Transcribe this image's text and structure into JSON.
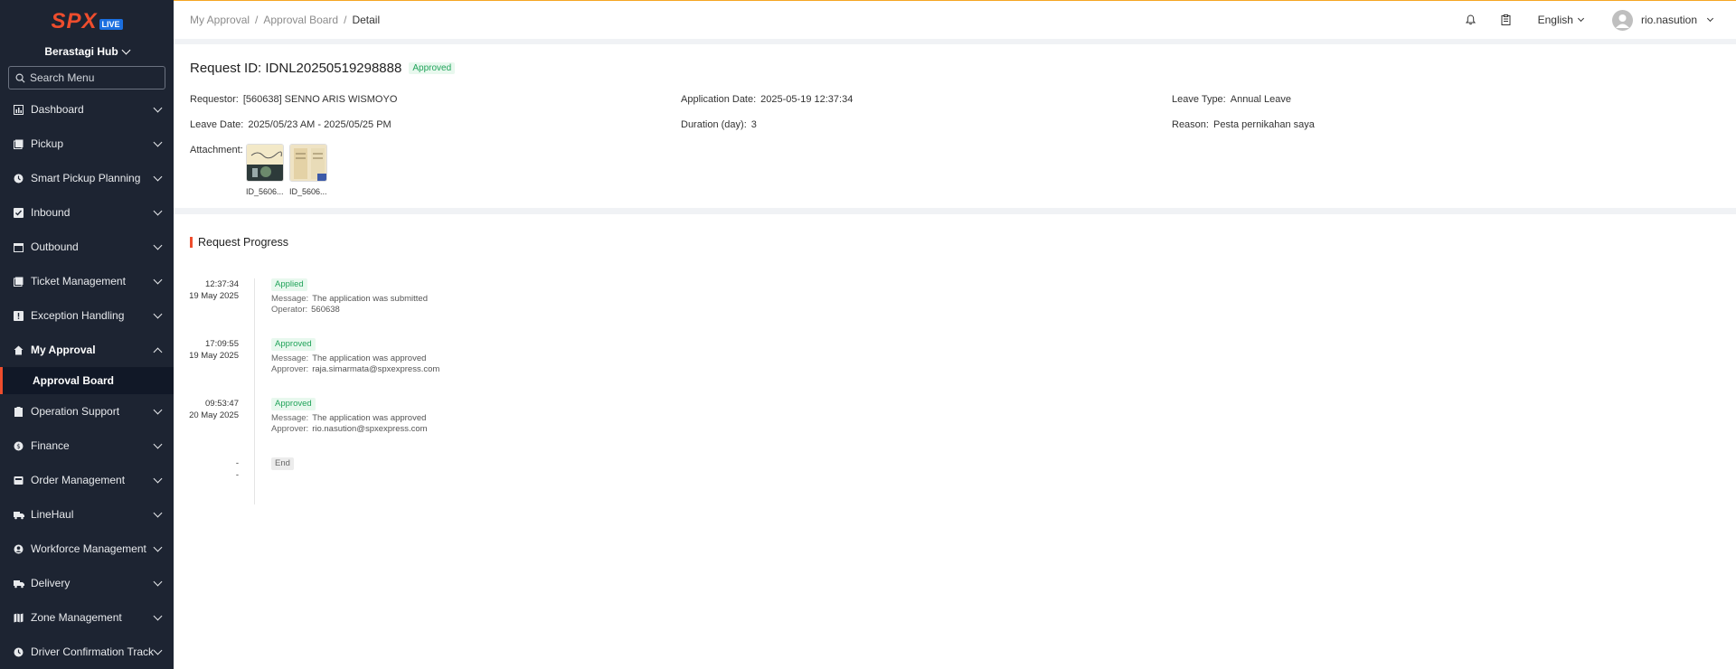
{
  "sidebar": {
    "logo_text": "SPX",
    "logo_badge": "LIVE",
    "hub": "Berastagi Hub",
    "search_placeholder": "Search Menu",
    "items": [
      {
        "label": "Dashboard",
        "icon": "bar-chart-icon"
      },
      {
        "label": "Pickup",
        "icon": "box-icon"
      },
      {
        "label": "Smart Pickup Planning",
        "icon": "clock-icon"
      },
      {
        "label": "Inbound",
        "icon": "check-box-icon"
      },
      {
        "label": "Outbound",
        "icon": "calendar-icon"
      },
      {
        "label": "Ticket Management",
        "icon": "ticket-icon"
      },
      {
        "label": "Exception Handling",
        "icon": "alert-icon"
      },
      {
        "label": "My Approval",
        "icon": "home-icon"
      },
      {
        "label": "Operation Support",
        "icon": "clipboard-icon"
      },
      {
        "label": "Finance",
        "icon": "coin-icon"
      },
      {
        "label": "Order Management",
        "icon": "inbox-icon"
      },
      {
        "label": "LineHaul",
        "icon": "truck-icon"
      },
      {
        "label": "Workforce Management",
        "icon": "user-circle-icon"
      },
      {
        "label": "Delivery",
        "icon": "delivery-truck-icon"
      },
      {
        "label": "Zone Management",
        "icon": "map-icon"
      },
      {
        "label": "Driver Confirmation Track...",
        "icon": "clock-check-icon"
      }
    ],
    "submenu_active": "Approval Board"
  },
  "header": {
    "breadcrumb": [
      "My Approval",
      "Approval Board",
      "Detail"
    ],
    "language": "English",
    "username": "rio.nasution"
  },
  "detail": {
    "title": "Request ID: IDNL20250519298888",
    "status": "Approved",
    "requestor_label": "Requestor:",
    "requestor": "[560638] SENNO ARIS WISMOYO",
    "application_date_label": "Application Date:",
    "application_date": "2025-05-19 12:37:34",
    "leave_type_label": "Leave Type:",
    "leave_type": "Annual Leave",
    "leave_date_label": "Leave Date:",
    "leave_date": "2025/05/23 AM - 2025/05/25 PM",
    "duration_label": "Duration (day):",
    "duration": "3",
    "reason_label": "Reason:",
    "reason": "Pesta pernikahan saya",
    "attachment_label": "Attachment:",
    "attachments": [
      "ID_5606...",
      "ID_5606..."
    ]
  },
  "progress": {
    "title": "Request Progress",
    "entries": [
      {
        "time": "12:37:34",
        "date": "19 May 2025",
        "status": "Applied",
        "msg_label": "Message:",
        "message": "The application was submitted",
        "who_label": "Operator:",
        "who": "560638"
      },
      {
        "time": "17:09:55",
        "date": "19 May 2025",
        "status": "Approved",
        "msg_label": "Message:",
        "message": "The application was approved",
        "who_label": "Approver:",
        "who": "raja.simarmata@spxexpress.com"
      },
      {
        "time": "09:53:47",
        "date": "20 May 2025",
        "status": "Approved",
        "msg_label": "Message:",
        "message": "The application was approved",
        "who_label": "Approver:",
        "who": "rio.nasution@spxexpress.com"
      }
    ],
    "end": {
      "time": "-",
      "date": "-",
      "status": "End"
    }
  },
  "colors": {
    "accent": "#ee4d2d",
    "sidebar_bg": "#1d2432",
    "success": "#21a35a"
  }
}
